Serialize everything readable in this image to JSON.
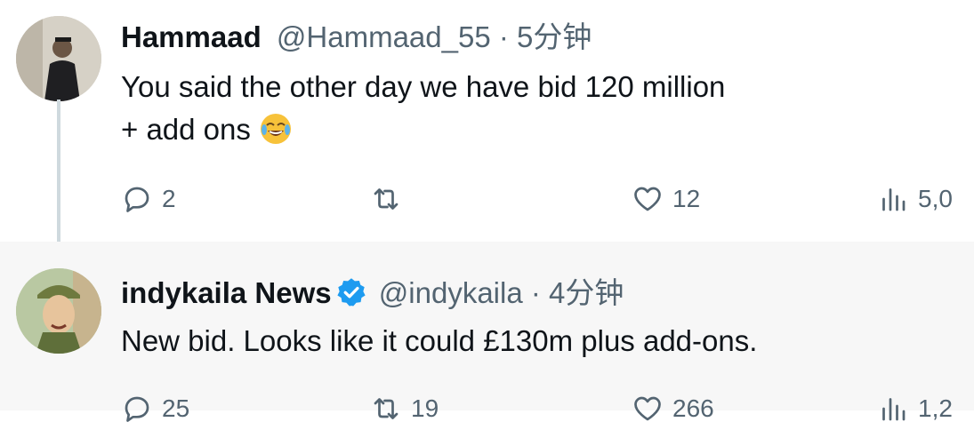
{
  "tweet1": {
    "name": "Hammaad",
    "handle": "@Hammaad_55",
    "sep": " · ",
    "time": "5分钟",
    "line1": "You said the other day we have bid 120 million",
    "line2": " + add ons",
    "emoji": "face-with-tears-of-joy",
    "replies": "2",
    "likes": "12",
    "views": "5,0"
  },
  "tweet2": {
    "name": "indykaila News",
    "verified": true,
    "handle": "@indykaila",
    "sep": " · ",
    "time": "4分钟",
    "line1": "New bid. Looks like it could £130m plus add-ons.",
    "replies": "25",
    "retweets": "19",
    "likes": "266",
    "views": "1,2"
  },
  "colors": {
    "muted": "#536471",
    "verified": "#1d9bf0",
    "text": "#0f1419"
  }
}
